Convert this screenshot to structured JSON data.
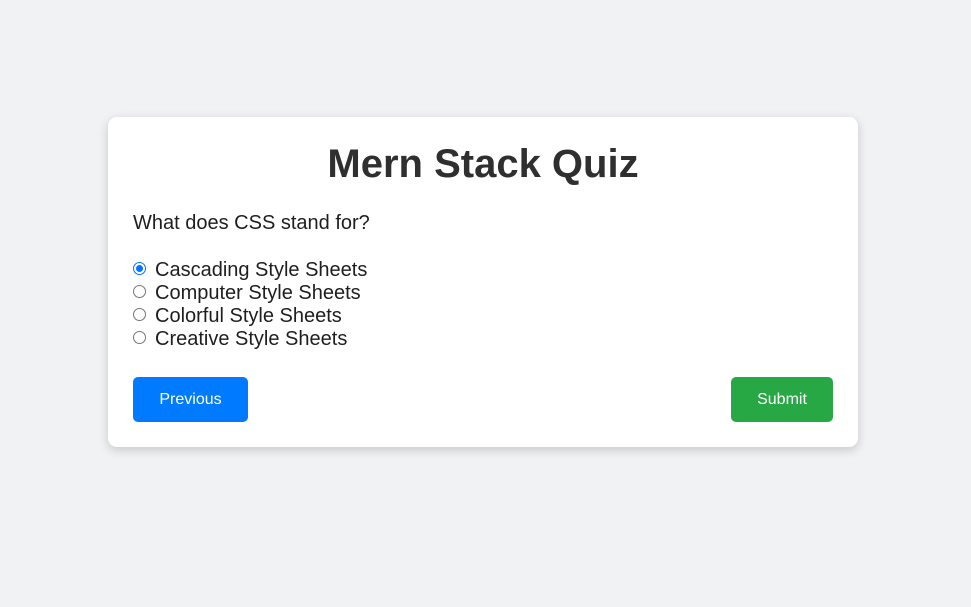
{
  "quiz": {
    "title": "Mern Stack Quiz",
    "question": "What does CSS stand for?",
    "options": [
      {
        "label": "Cascading Style Sheets",
        "checked": true
      },
      {
        "label": "Computer Style Sheets",
        "checked": false
      },
      {
        "label": "Colorful Style Sheets",
        "checked": false
      },
      {
        "label": "Creative Style Sheets",
        "checked": false
      }
    ],
    "previous_label": "Previous",
    "submit_label": "Submit"
  },
  "colors": {
    "background": "#f1f2f4",
    "card": "#ffffff",
    "previous_button": "#007bff",
    "submit_button": "#28a745",
    "radio_accent": "#0075ff",
    "title_text": "#2f2f2f"
  }
}
